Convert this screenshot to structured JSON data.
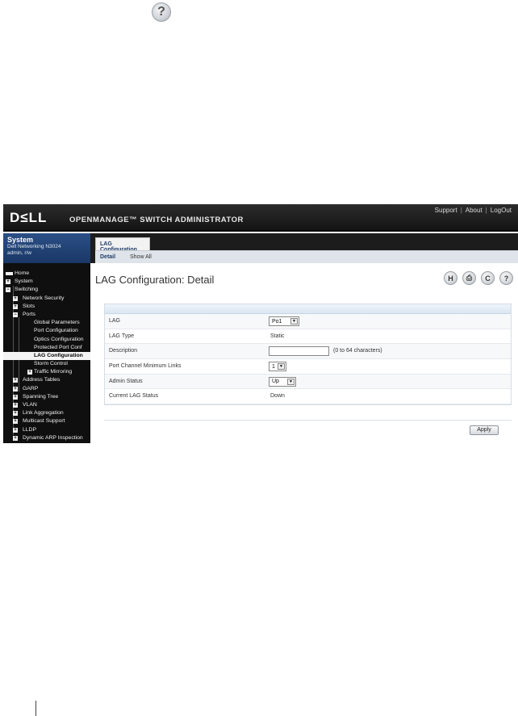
{
  "document": {
    "help_glyph": "?"
  },
  "header": {
    "logo": "D≤LL",
    "title": "OPENMANAGE™ SWITCH ADMINISTRATOR",
    "links": [
      "Support",
      "About",
      "LogOut"
    ]
  },
  "system": {
    "title": "System",
    "model": "Dell Networking N3024",
    "user": "admin, r/w"
  },
  "nav": [
    {
      "label": "Home",
      "level": 0,
      "icon": "home"
    },
    {
      "label": "System",
      "level": 0,
      "icon": "plus"
    },
    {
      "label": "Switching",
      "level": 0,
      "icon": "minus"
    },
    {
      "label": "Network Security",
      "level": 1,
      "icon": "plus"
    },
    {
      "label": "Slots",
      "level": 1,
      "icon": "plus"
    },
    {
      "label": "Ports",
      "level": 1,
      "icon": "minus"
    },
    {
      "label": "Global Parameters",
      "level": 2
    },
    {
      "label": "Port Configuration",
      "level": 2
    },
    {
      "label": "Optics Configuration",
      "level": 2
    },
    {
      "label": "Protected Port Conf",
      "level": 2
    },
    {
      "label": "LAG Configuration",
      "level": 2,
      "selected": true
    },
    {
      "label": "Storm Control",
      "level": 2
    },
    {
      "label": "Traffic Mirroring",
      "level": 2,
      "icon": "plus"
    },
    {
      "label": "Address Tables",
      "level": 1,
      "icon": "plus"
    },
    {
      "label": "GARP",
      "level": 1,
      "icon": "plus"
    },
    {
      "label": "Spanning Tree",
      "level": 1,
      "icon": "plus"
    },
    {
      "label": "VLAN",
      "level": 1,
      "icon": "plus"
    },
    {
      "label": "Link Aggregation",
      "level": 1,
      "icon": "plus"
    },
    {
      "label": "Multicast Support",
      "level": 1,
      "icon": "plus"
    },
    {
      "label": "LLDP",
      "level": 1,
      "icon": "plus"
    },
    {
      "label": "Dynamic ARP Inspection",
      "level": 1,
      "icon": "plus"
    }
  ],
  "tabs": {
    "main": "LAG Configuration",
    "sub": [
      "Detail",
      "Show All"
    ]
  },
  "page": {
    "title": "LAG Configuration: Detail",
    "actions": [
      {
        "name": "save",
        "glyph": "H"
      },
      {
        "name": "print",
        "glyph": "⎙"
      },
      {
        "name": "refresh",
        "glyph": "C"
      },
      {
        "name": "help",
        "glyph": "?"
      }
    ]
  },
  "form": {
    "lag_label": "LAG",
    "lag_value": "Po1",
    "lag_type_label": "LAG Type",
    "lag_type_value": "Static",
    "description_label": "Description",
    "description_value": "",
    "description_hint": "(0 to 64 characters)",
    "min_links_label": "Port Channel Minimum Links",
    "min_links_value": "1",
    "admin_status_label": "Admin Status",
    "admin_status_value": "Up",
    "current_status_label": "Current LAG Status",
    "current_status_value": "Down",
    "apply_label": "Apply"
  }
}
